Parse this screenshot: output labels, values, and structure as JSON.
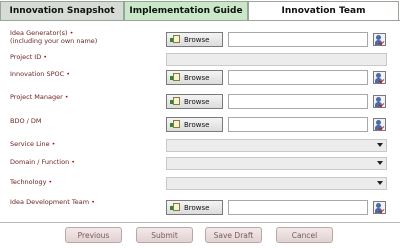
{
  "tabs": [
    {
      "label": "Innovation Snapshot"
    },
    {
      "label": "Implementation Guide"
    },
    {
      "label": "Innovation Team"
    }
  ],
  "fields": {
    "idea_generators": {
      "label": "Idea Generator(s)",
      "sublabel": "(including your own name)",
      "required_marker": "•",
      "browse_label": "Browse",
      "value": ""
    },
    "project_id": {
      "label": "Project ID",
      "required_marker": "•",
      "value": ""
    },
    "innovation_spoc": {
      "label": "Innovation SPOC",
      "required_marker": "•",
      "browse_label": "Browse",
      "value": ""
    },
    "project_manager": {
      "label": "Project Manager",
      "required_marker": "•",
      "browse_label": "Browse",
      "value": ""
    },
    "bdo_dm": {
      "label": "BDO / DM",
      "browse_label": "Browse",
      "value": ""
    },
    "service_line": {
      "label": "Service Line",
      "required_marker": "•",
      "selected": ""
    },
    "domain_function": {
      "label": "Domain / Function",
      "required_marker": "•",
      "selected": ""
    },
    "technology": {
      "label": "Technology",
      "required_marker": "•",
      "selected": ""
    },
    "idea_development_team": {
      "label": "Idea Development Team",
      "required_marker": "•",
      "browse_label": "Browse",
      "value": ""
    }
  },
  "buttons": {
    "previous": "Previous",
    "submit": "Submit",
    "save_draft": "Save Draft",
    "cancel": "Cancel"
  },
  "icons": {
    "browse": "folder-browse-icon",
    "people_picker": "people-picker-icon",
    "dropdown": "chevron-down-icon"
  },
  "colors": {
    "label_text": "#6b2222",
    "required": "#cc0000",
    "active_tab": "#c8e8c8",
    "button_text": "#7a5a5a"
  }
}
